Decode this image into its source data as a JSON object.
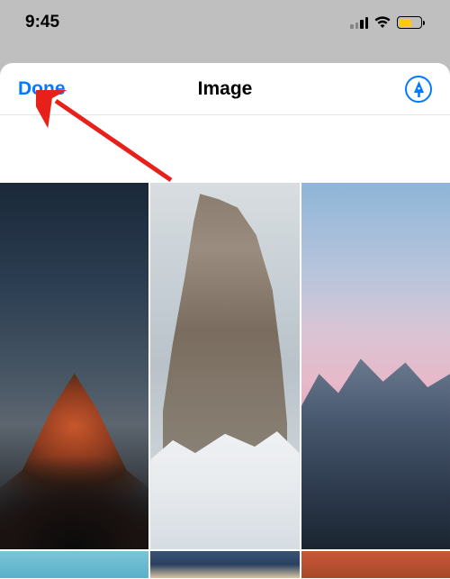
{
  "status": {
    "time": "9:45"
  },
  "nav": {
    "done_label": "Done",
    "title": "Image"
  },
  "colors": {
    "accent": "#007aff",
    "battery_fill": "#ffcc00"
  }
}
